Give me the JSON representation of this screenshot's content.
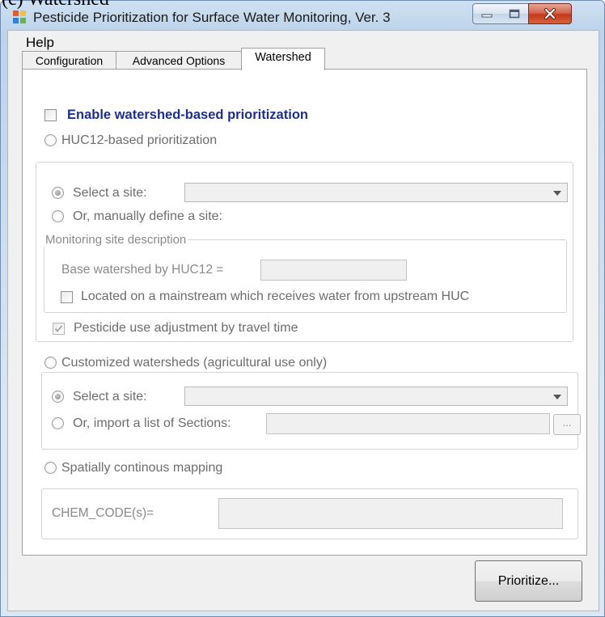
{
  "caption": "(c) Watershed",
  "window": {
    "title": "Pesticide Prioritization for Surface Water Monitoring, Ver. 3",
    "controls": {
      "minimize_icon": "minimize-icon",
      "maximize_icon": "maximize-icon",
      "close_icon": "close-icon"
    }
  },
  "menu": {
    "help": "Help"
  },
  "tabs": [
    {
      "label": "Configuration",
      "active": false
    },
    {
      "label": "Advanced Options",
      "active": false
    },
    {
      "label": "Watershed",
      "active": true
    }
  ],
  "watershed": {
    "enable_label": "Enable watershed-based prioritization",
    "enable_checked": false,
    "huc12": {
      "label": "HUC12-based prioritization",
      "select_site_label": "Select a site:",
      "select_site_value": "",
      "manual_label": "Or, manually define a site:",
      "monitoring_group_label": "Monitoring site description",
      "base_watershed_label": "Base watershed by HUC12 =",
      "base_watershed_value": "",
      "mainstream_label": "Located on a mainstream which receives water from upstream HUC",
      "mainstream_checked": false,
      "travel_time_label": "Pesticide use adjustment by travel time",
      "travel_time_checked": true
    },
    "custom": {
      "label": "Customized watersheds (agricultural use only)",
      "select_site_label": "Select a site:",
      "select_site_value": "",
      "import_label": "Or, import a list of Sections:",
      "import_value": "",
      "browse_label": "..."
    },
    "spatial": {
      "label": "Spatially continous mapping",
      "chem_code_label": "CHEM_CODE(s)=",
      "chem_code_value": ""
    }
  },
  "buttons": {
    "prioritize": "Prioritize..."
  },
  "colors": {
    "title_bar": "#c7daee",
    "enable_label": "#1f2f8f",
    "close_button": "#c8452a"
  }
}
